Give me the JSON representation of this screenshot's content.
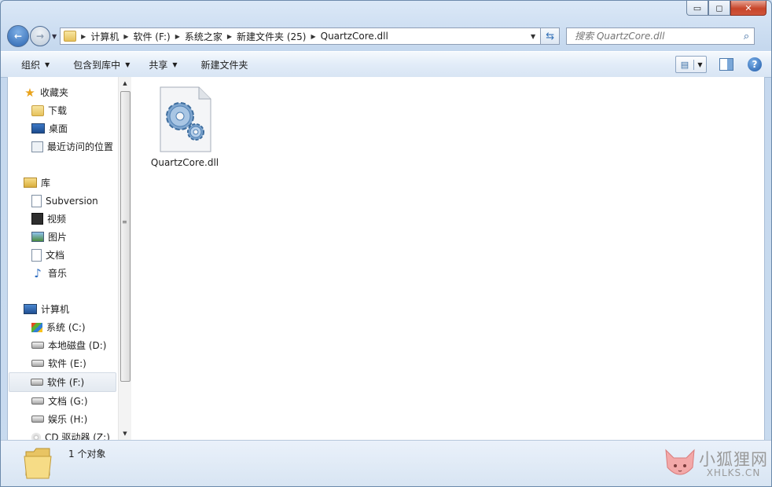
{
  "window": {
    "minimize_label": "▭",
    "maximize_label": "◻",
    "close_label": "✕"
  },
  "navigation": {
    "breadcrumbs": [
      "计算机",
      "软件 (F:)",
      "系统之家",
      "新建文件夹 (25)",
      "QuartzCore.dll"
    ],
    "search_placeholder": "搜索 QuartzCore.dll"
  },
  "toolbar": {
    "organize": "组织",
    "include_in_library": "包含到库中",
    "share": "共享",
    "new_folder": "新建文件夹"
  },
  "sidebar": {
    "favorites": {
      "label": "收藏夹",
      "items": [
        "下载",
        "桌面",
        "最近访问的位置"
      ]
    },
    "libraries": {
      "label": "库",
      "items": [
        "Subversion",
        "视频",
        "图片",
        "文档",
        "音乐"
      ]
    },
    "computer": {
      "label": "计算机",
      "items": [
        "系统 (C:)",
        "本地磁盘 (D:)",
        "软件 (E:)",
        "软件 (F:)",
        "文档 (G:)",
        "娱乐 (H:)",
        "CD 驱动器 (Z:)"
      ],
      "selected": "软件 (F:)"
    }
  },
  "files": [
    {
      "name": "QuartzCore.dll",
      "icon": "dll-gear-icon"
    }
  ],
  "status": {
    "count_text": "1 个对象"
  },
  "watermark": {
    "cn": "小狐狸网",
    "en": "XHLKS.CN"
  },
  "colors": {
    "accent": "#3673b8",
    "close_red": "#c7452a",
    "selection": "#e3e9f0"
  }
}
